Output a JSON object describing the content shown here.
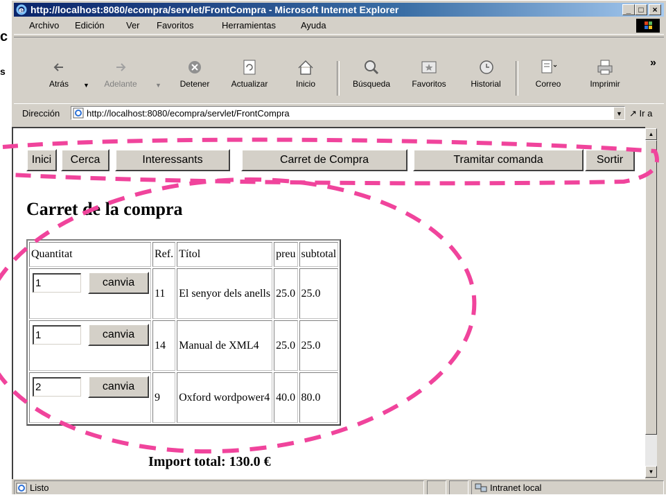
{
  "background": {
    "fragment1": "c",
    "fragment2": "s"
  },
  "window": {
    "title": "http://localhost:8080/ecompra/servlet/FrontCompra - Microsoft Internet Explorer",
    "caption": {
      "minimize": "_",
      "maximize": "□",
      "close": "×"
    }
  },
  "menu": {
    "archivo": "Archivo",
    "edicion": "Edición",
    "ver": "Ver",
    "favoritos": "Favoritos",
    "herramientas": "Herramientas",
    "ayuda": "Ayuda"
  },
  "toolbar": {
    "atras": "Atrás",
    "adelante": "Adelante",
    "detener": "Detener",
    "actualizar": "Actualizar",
    "inicio": "Inicio",
    "busqueda": "Búsqueda",
    "favoritos": "Favoritos",
    "historial": "Historial",
    "correo": "Correo",
    "imprimir": "Imprimir",
    "overflow": "»"
  },
  "address": {
    "label": "Dirección",
    "url": "http://localhost:8080/ecompra/servlet/FrontCompra",
    "go": "Ir a"
  },
  "nav": {
    "inici": "Inici",
    "cerca": "Cerca",
    "interessants": "Interessants",
    "carret": "Carret de Compra",
    "tramitar": "Tramitar comanda",
    "sortir": "Sortir"
  },
  "page": {
    "title": "Carret de la compra",
    "total": "Import total: 130.0 €"
  },
  "table": {
    "headers": {
      "quantitat": "Quantitat",
      "ref": "Ref.",
      "titol": "Títol",
      "preu": "preu",
      "subtotal": "subtotal"
    },
    "update_label": "canvia",
    "rows": [
      {
        "qty": "1",
        "ref": "11",
        "title": "El senyor dels anells",
        "price": "25.0",
        "subtotal": "25.0"
      },
      {
        "qty": "1",
        "ref": "14",
        "title": "Manual de XML4",
        "price": "25.0",
        "subtotal": "25.0"
      },
      {
        "qty": "2",
        "ref": "9",
        "title": "Oxford wordpower4",
        "price": "40.0",
        "subtotal": "80.0"
      }
    ]
  },
  "status": {
    "left": "Listo",
    "zone": "Intranet local"
  },
  "colors": {
    "annotation": "#f0449c",
    "titlebar": "#0a246a"
  }
}
